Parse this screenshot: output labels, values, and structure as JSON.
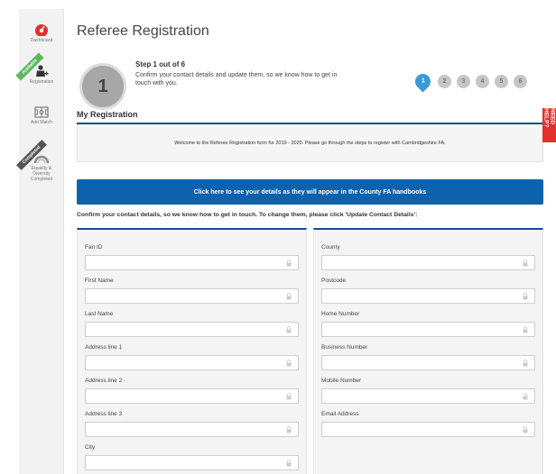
{
  "sidebar": {
    "items": [
      {
        "label": "Dashboard",
        "icon": "dashboard-icon"
      },
      {
        "label": "Registration",
        "icon": "referee-icon",
        "ribbon": "Available"
      },
      {
        "label": "Add Match",
        "icon": "pitch-icon"
      },
      {
        "label": "Equality & Diversity Completed",
        "label_lines": [
          "Equality &",
          "Diversity",
          "Completed"
        ],
        "icon": "gauge-icon",
        "ribbon": "Completed"
      }
    ]
  },
  "header": {
    "title": "Referee Registration",
    "step_number": "1",
    "step_title": "Step 1 out of 6",
    "step_description": "Confirm your contact details and update them, so we know how to get in touch with you."
  },
  "steps": [
    "1",
    "2",
    "3",
    "4",
    "5",
    "6"
  ],
  "need_help": "NEED HELP?",
  "section_title": "My Registration",
  "welcome_text": "Welcome to the Referee Registration form for 2019 - 2020. Please go through the steps to register with Cambridgeshire FA.",
  "handbook_button": "Click here to see your details as they will appear in the County FA handbooks",
  "confirm_text": "Confirm your contact details, so we know how to get in touch. To change them, please click 'Update Contact Details':",
  "form": {
    "left": [
      {
        "label": "Fan ID",
        "value": ""
      },
      {
        "label": "First Name",
        "value": ""
      },
      {
        "label": "Last Name",
        "value": ""
      },
      {
        "label": "Address line 1",
        "value": ""
      },
      {
        "label": "Address line 2",
        "value": ""
      },
      {
        "label": "Address line 3",
        "value": ""
      },
      {
        "label": "City",
        "value": ""
      }
    ],
    "right": [
      {
        "label": "County",
        "value": ""
      },
      {
        "label": "Postcode",
        "value": ""
      },
      {
        "label": "Home Number",
        "value": ""
      },
      {
        "label": "Business Number",
        "value": ""
      },
      {
        "label": "Mobile Number",
        "value": ""
      },
      {
        "label": "Email Address",
        "value": ""
      }
    ]
  },
  "colors": {
    "primary_blue": "#0d62ad",
    "dark_blue": "#0d4b99",
    "active_step": "#3a9ad6",
    "help_red": "#e4302b",
    "available_green": "#5cb85c",
    "completed_grey": "#555555"
  }
}
